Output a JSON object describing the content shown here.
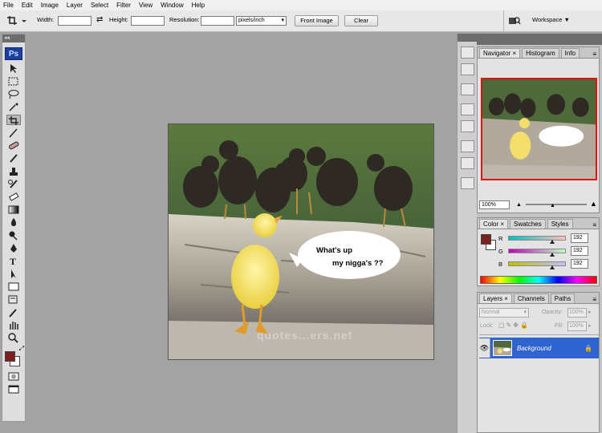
{
  "menu": [
    "File",
    "Edit",
    "Image",
    "Layer",
    "Select",
    "Filter",
    "View",
    "Window",
    "Help"
  ],
  "options": {
    "width_label": "Width:",
    "height_label": "Height:",
    "resolution_label": "Resolution:",
    "units": "pixels/inch",
    "front_image": "Front Image",
    "clear": "Clear",
    "workspace": "Workspace"
  },
  "toolbox": {
    "logo": "Ps"
  },
  "navigator": {
    "tabs": [
      "Navigator",
      "Histogram",
      "Info"
    ],
    "zoom": "100%"
  },
  "color_panel": {
    "tabs": [
      "Color",
      "Swatches",
      "Styles"
    ],
    "channels": [
      {
        "label": "R",
        "value": "192"
      },
      {
        "label": "G",
        "value": "192"
      },
      {
        "label": "B",
        "value": "192"
      }
    ]
  },
  "layers_panel": {
    "tabs": [
      "Layers",
      "Channels",
      "Paths"
    ],
    "blend_mode": "Normal",
    "opacity_label": "Opacity:",
    "opacity_value": "100%",
    "lock_label": "Lock:",
    "fill_label": "Fill:",
    "fill_value": "100%",
    "layer_name": "Background"
  },
  "canvas": {
    "speech_line1": "What's up",
    "speech_line2": "my nigga's ??",
    "watermark": "quotes...ers.net"
  },
  "colors": {
    "foreground": "#7a1f1f",
    "background": "#ffffff",
    "layer_selected": "#2f63d0"
  }
}
